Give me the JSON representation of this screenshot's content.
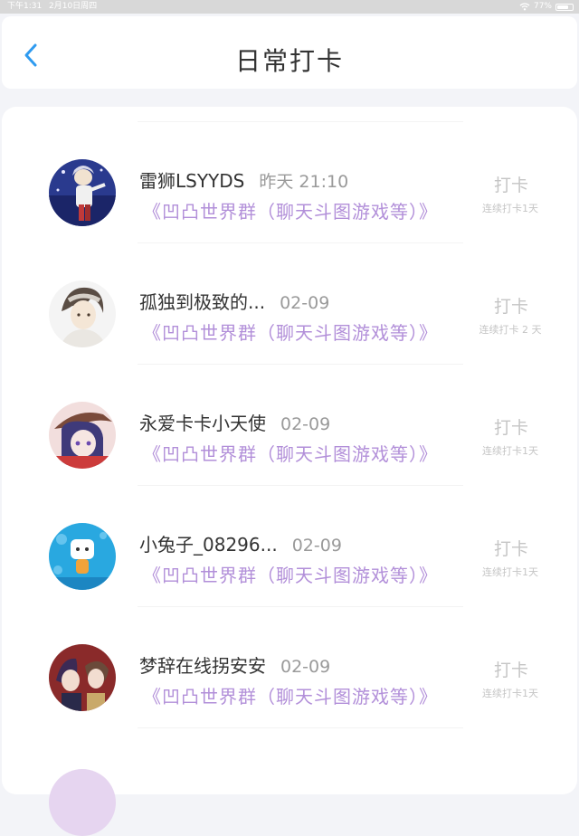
{
  "status_bar": {
    "time": "下午1:31",
    "date": "2月10日周四",
    "battery": "77%",
    "battery_level": 0.77
  },
  "header": {
    "title": "日常打卡"
  },
  "checkins": [
    {
      "name": "雷狮LSYYDS",
      "time": "昨天 21:10",
      "group": "《凹凸世界群（聊天斗图游戏等）》",
      "action": "打卡",
      "streak": "连续打卡1天"
    },
    {
      "name": "孤独到极致的...",
      "time": "02-09",
      "group": "《凹凸世界群（聊天斗图游戏等）》",
      "action": "打卡",
      "streak": "连续打卡 2 天"
    },
    {
      "name": "永爱卡卡小天使",
      "time": "02-09",
      "group": "《凹凸世界群（聊天斗图游戏等）》",
      "action": "打卡",
      "streak": "连续打卡1天"
    },
    {
      "name": "小兔子_08296...",
      "time": "02-09",
      "group": "《凹凸世界群（聊天斗图游戏等）》",
      "action": "打卡",
      "streak": "连续打卡1天"
    },
    {
      "name": "梦辞在线拐安安",
      "time": "02-09",
      "group": "《凹凸世界群（聊天斗图游戏等）》",
      "action": "打卡",
      "streak": "连续打卡1天"
    }
  ],
  "colors": {
    "accent": "#2f9bf0",
    "group_text": "#b28fd9",
    "muted": "#c5c5c5"
  }
}
